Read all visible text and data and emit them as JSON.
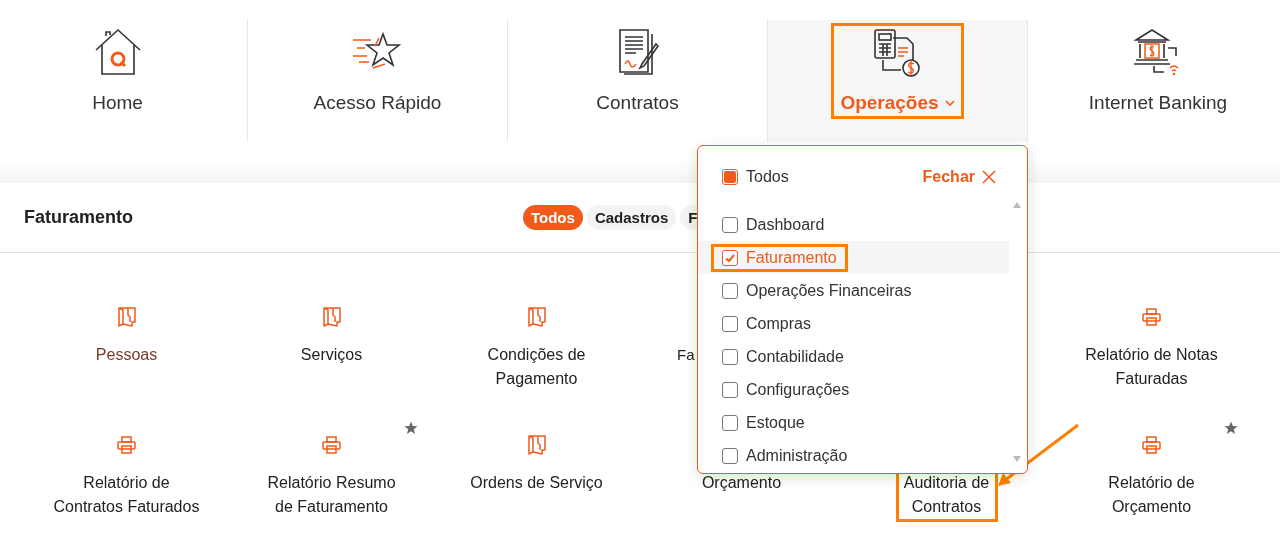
{
  "nav": {
    "tabs": [
      {
        "label": "Home",
        "kind": "home",
        "selected": false,
        "annotated": false
      },
      {
        "label": "Acesso Rápido",
        "kind": "star",
        "selected": false,
        "annotated": false
      },
      {
        "label": "Contratos",
        "kind": "contract",
        "selected": false,
        "annotated": false
      },
      {
        "label": "Operações",
        "kind": "operations",
        "selected": true,
        "annotated": true
      },
      {
        "label": "Internet Banking",
        "kind": "bank",
        "selected": false,
        "annotated": false
      }
    ]
  },
  "section": {
    "title": "Faturamento",
    "filters": [
      {
        "label": "Todos",
        "selected": true
      },
      {
        "label": "Cadastros",
        "selected": false
      },
      {
        "label": "F",
        "selected": false
      }
    ]
  },
  "items": [
    {
      "label": "Pessoas",
      "kind": "document",
      "hovered": true
    },
    {
      "label": "Serviços",
      "kind": "document",
      "hovered": false
    },
    {
      "label": "Condições de Pagamento",
      "kind": "document",
      "hovered": false
    },
    {
      "label": "Fa",
      "kind": "partial",
      "hovered": false
    },
    {
      "kind": "covered"
    },
    {
      "label": "Relatório de Notas Faturadas",
      "kind": "printer",
      "hovered": false
    },
    {
      "label": "Relatório de Contratos Faturados",
      "kind": "printer",
      "hovered": false
    },
    {
      "label": "Relatório Resumo de Faturamento",
      "kind": "printer",
      "hovered": false,
      "starred": true
    },
    {
      "label": "Ordens de Serviço",
      "kind": "document",
      "hovered": false
    },
    {
      "label": "Orçamento",
      "kind": "covered",
      "hovered": false
    },
    {
      "label": "Auditoria de Contratos",
      "kind": "covered",
      "hovered": false,
      "annotated": true
    },
    {
      "label": "Relatório de Orçamento",
      "kind": "printer",
      "hovered": false,
      "starred": true
    }
  ],
  "dropdown": {
    "all": {
      "label": "Todos",
      "checked": true
    },
    "close": "Fechar",
    "options": [
      {
        "label": "Dashboard",
        "checked": false
      },
      {
        "label": "Faturamento",
        "checked": true,
        "annotated": true
      },
      {
        "label": "Operações Financeiras",
        "checked": false
      },
      {
        "label": "Compras",
        "checked": false
      },
      {
        "label": "Contabilidade",
        "checked": false
      },
      {
        "label": "Configurações",
        "checked": false
      },
      {
        "label": "Estoque",
        "checked": false
      },
      {
        "label": "Administração",
        "checked": false
      }
    ]
  }
}
